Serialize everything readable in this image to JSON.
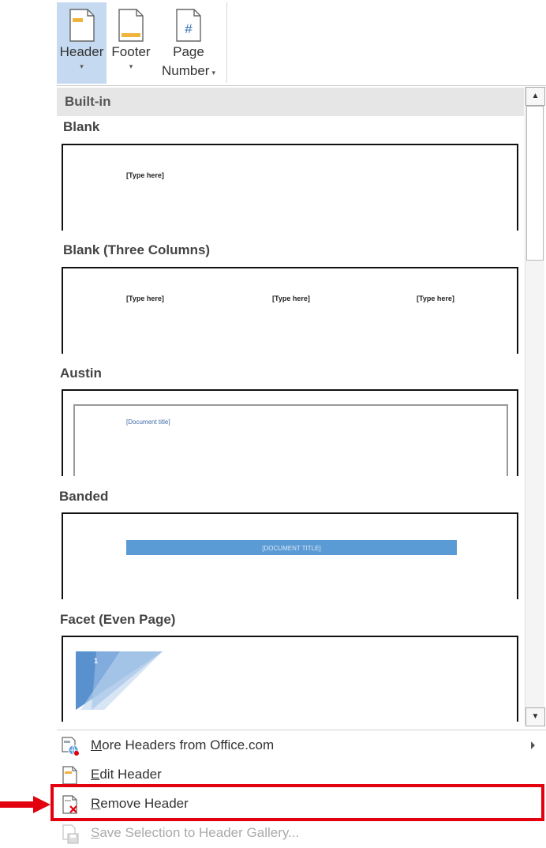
{
  "ribbon": {
    "header": {
      "label": "Header",
      "caret": "▾",
      "icon": "header-page-icon"
    },
    "footer": {
      "label": "Footer",
      "caret": "▾",
      "icon": "footer-page-icon"
    },
    "page_number": {
      "label_line1": "Page",
      "label_line2": "Number",
      "caret": "▾",
      "icon": "page-number-icon",
      "glyph": "#"
    }
  },
  "gallery": {
    "category": "Built-in",
    "items": [
      {
        "title": "Blank",
        "placeholders": [
          "[Type here]"
        ]
      },
      {
        "title": "Blank (Three Columns)",
        "placeholders": [
          "[Type here]",
          "[Type here]",
          "[Type here]"
        ]
      },
      {
        "title": "Austin",
        "placeholders": [
          "[Document title]"
        ]
      },
      {
        "title": "Banded",
        "placeholders": [
          "[DOCUMENT TITLE]"
        ]
      },
      {
        "title": "Facet (Even Page)",
        "placeholders": [
          "1"
        ]
      }
    ]
  },
  "menu": {
    "items": [
      {
        "accesskey": "M",
        "rest": "ore Headers from Office.com",
        "icon": "office-web-icon",
        "enabled": true,
        "submenu": true
      },
      {
        "accesskey": "E",
        "rest": "dit Header",
        "icon": "edit-header-icon",
        "enabled": true,
        "submenu": false
      },
      {
        "accesskey": "R",
        "rest": "emove Header",
        "icon": "remove-header-icon",
        "enabled": true,
        "submenu": false,
        "highlighted": true
      },
      {
        "accesskey": "S",
        "rest": "ave Selection to Header Gallery...",
        "icon": "save-selection-icon",
        "enabled": false,
        "submenu": false
      }
    ]
  },
  "colors": {
    "highlight": "#e3000f",
    "ribbon_active": "#c5d9f1",
    "banded_bar": "#5b9bd5",
    "facet_blue": "#4a86c8"
  }
}
